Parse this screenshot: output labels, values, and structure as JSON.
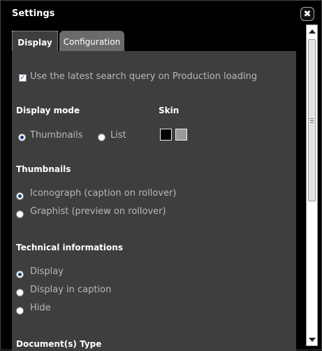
{
  "dialog": {
    "title": "Settings",
    "close_glyph": "✖"
  },
  "tabs": [
    {
      "label": "Display",
      "active": true
    },
    {
      "label": "Configuration",
      "active": false
    }
  ],
  "display": {
    "use_latest_query": {
      "label": "Use the latest search query on Production loading",
      "checked": true
    },
    "display_mode": {
      "heading": "Display mode",
      "options": [
        {
          "label": "Thumbnails",
          "selected": true
        },
        {
          "label": "List",
          "selected": false
        }
      ]
    },
    "skin": {
      "heading": "Skin",
      "swatches": [
        {
          "name": "black",
          "color": "#000000"
        },
        {
          "name": "grey",
          "color": "#9a9a9a"
        }
      ]
    },
    "thumbnails": {
      "heading": "Thumbnails",
      "options": [
        {
          "label": "Iconograph (caption on rollover)",
          "selected": true
        },
        {
          "label": "Graphist (preview on rollover)",
          "selected": false
        }
      ]
    },
    "technical": {
      "heading": "Technical informations",
      "options": [
        {
          "label": "Display",
          "selected": true
        },
        {
          "label": "Display in caption",
          "selected": false
        },
        {
          "label": "Hide",
          "selected": false
        }
      ]
    },
    "doc_type": {
      "heading": "Document(s) Type"
    }
  }
}
